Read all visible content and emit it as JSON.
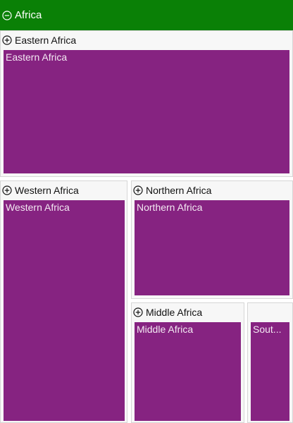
{
  "header": {
    "title": "Africa",
    "icon": "collapse-circle-icon",
    "bg_color": "#0a8006"
  },
  "regions": {
    "eastern": {
      "header_label": "Eastern Africa",
      "content_label": "Eastern Africa",
      "icon": "expand-circle-icon"
    },
    "western": {
      "header_label": "Western Africa",
      "content_label": "Western Africa",
      "icon": "expand-circle-icon"
    },
    "northern": {
      "header_label": "Northern Africa",
      "content_label": "Northern Africa",
      "icon": "expand-circle-icon"
    },
    "middle": {
      "header_label": "Middle Africa",
      "content_label": "Middle Africa",
      "icon": "expand-circle-icon"
    },
    "southern": {
      "content_label": "Sout..."
    }
  },
  "colors": {
    "tile_fill": "#862381",
    "tile_text": "#f4e9f3",
    "tile_border": "#d6d6d6"
  }
}
